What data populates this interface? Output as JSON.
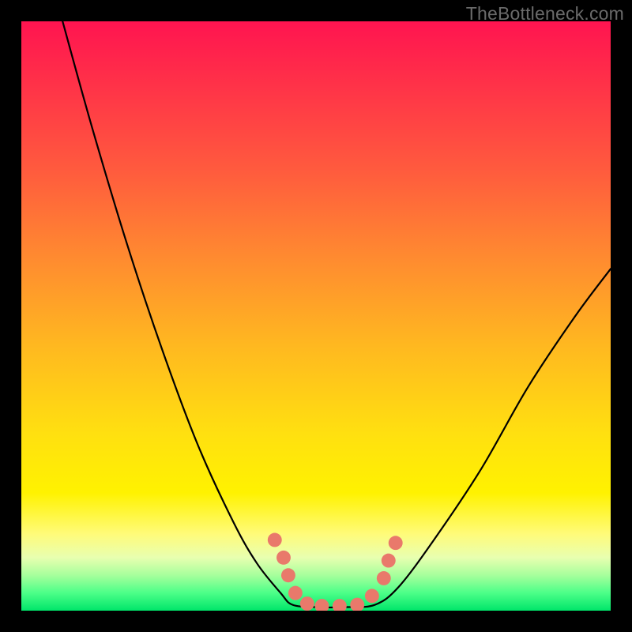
{
  "watermark": "TheBottleneck.com",
  "chart_data": {
    "type": "line",
    "title": "",
    "xlabel": "",
    "ylabel": "",
    "xlim": [
      0,
      100
    ],
    "ylim": [
      0,
      100
    ],
    "gradient_stops": [
      {
        "pos": 0,
        "color": "#ff1450"
      },
      {
        "pos": 8,
        "color": "#ff2a4a"
      },
      {
        "pos": 25,
        "color": "#ff5a3e"
      },
      {
        "pos": 40,
        "color": "#ff8a30"
      },
      {
        "pos": 55,
        "color": "#ffb820"
      },
      {
        "pos": 70,
        "color": "#ffe010"
      },
      {
        "pos": 80,
        "color": "#fff200"
      },
      {
        "pos": 87,
        "color": "#fffb7a"
      },
      {
        "pos": 91,
        "color": "#e8ffb0"
      },
      {
        "pos": 94,
        "color": "#a6ff9c"
      },
      {
        "pos": 97,
        "color": "#4cff88"
      },
      {
        "pos": 100,
        "color": "#00e56a"
      }
    ],
    "series": [
      {
        "name": "left-curve",
        "x": [
          7,
          12,
          18,
          24,
          30,
          36,
          40,
          44,
          46
        ],
        "y": [
          100,
          82,
          62,
          44,
          28,
          15,
          8,
          3,
          1
        ]
      },
      {
        "name": "flat-bottom",
        "x": [
          46,
          50,
          55,
          60
        ],
        "y": [
          1,
          0.6,
          0.6,
          1
        ]
      },
      {
        "name": "right-curve",
        "x": [
          60,
          64,
          70,
          78,
          86,
          94,
          100
        ],
        "y": [
          1,
          4,
          12,
          24,
          38,
          50,
          58
        ]
      }
    ],
    "markers": {
      "color": "#e9796b",
      "radius_pct": 1.2,
      "points": [
        {
          "x": 43.0,
          "y": 12.0
        },
        {
          "x": 44.5,
          "y": 9.0
        },
        {
          "x": 45.3,
          "y": 6.0
        },
        {
          "x": 46.5,
          "y": 3.0
        },
        {
          "x": 48.5,
          "y": 1.2
        },
        {
          "x": 51.0,
          "y": 0.8
        },
        {
          "x": 54.0,
          "y": 0.8
        },
        {
          "x": 57.0,
          "y": 1.0
        },
        {
          "x": 59.5,
          "y": 2.5
        },
        {
          "x": 61.5,
          "y": 5.5
        },
        {
          "x": 62.3,
          "y": 8.5
        },
        {
          "x": 63.5,
          "y": 11.5
        }
      ]
    }
  }
}
